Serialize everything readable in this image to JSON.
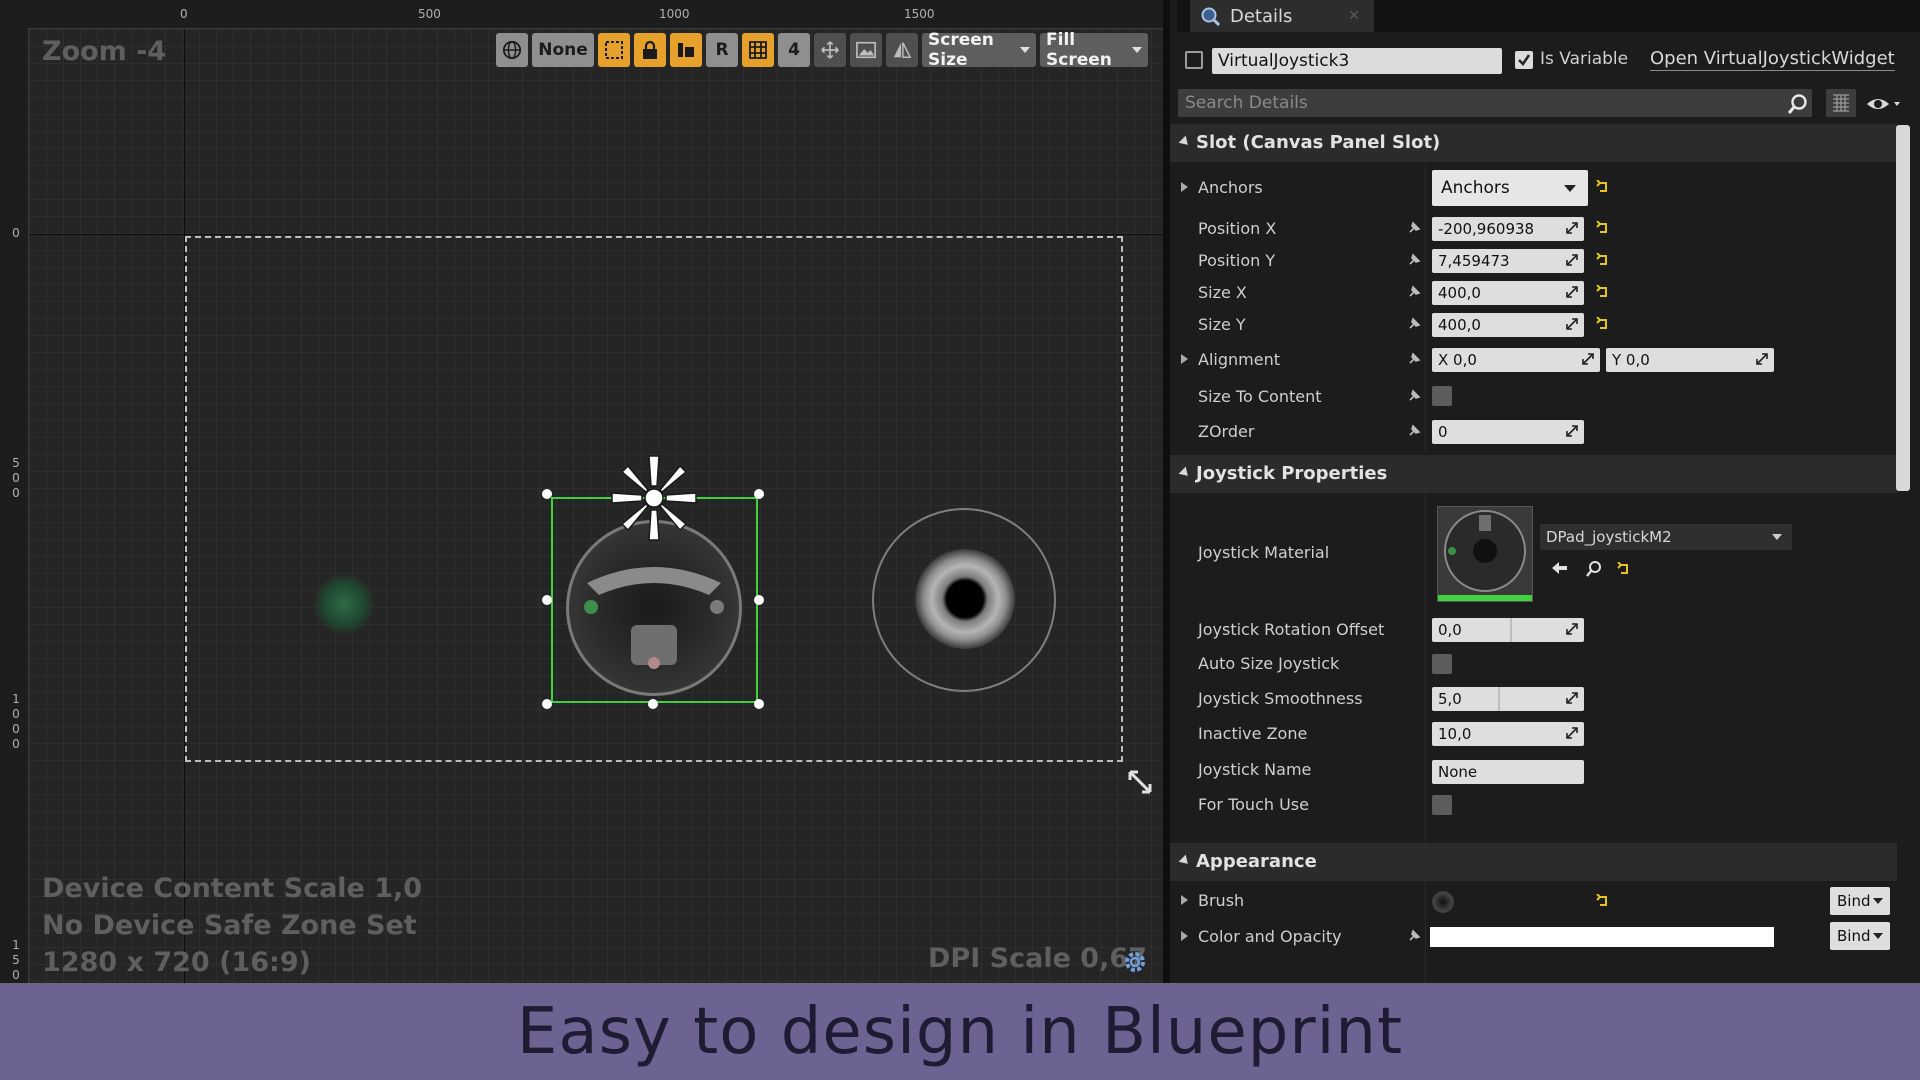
{
  "designer": {
    "zoom_label": "Zoom -4",
    "ruler_top_ticks": [
      "0",
      "500",
      "1000",
      "1500"
    ],
    "ruler_left_ticks": [
      "0",
      "500",
      "1000",
      "150"
    ],
    "device_content_scale": "Device Content Scale 1,0",
    "safe_zone": "No Device Safe Zone Set",
    "resolution": "1280 x 720 (16:9)",
    "dpi_scale": "DPI Scale 0,67",
    "toolbar": {
      "none_label": "None",
      "r_label": "R",
      "grid_snap_value": "4",
      "screen_size_label": "Screen Size",
      "fill_screen_label": "Fill Screen"
    }
  },
  "details": {
    "tab_label": "Details",
    "widget_name": "VirtualJoystick3",
    "is_variable_label": "Is Variable",
    "is_variable_checked": true,
    "open_widget_link": "Open VirtualJoystickWidget",
    "search_placeholder": "Search Details",
    "slot_section": "Slot (Canvas Panel Slot)",
    "anchors_label": "Anchors",
    "anchors_value": "Anchors",
    "position_x_label": "Position X",
    "position_x_value": "-200,960938",
    "position_y_label": "Position Y",
    "position_y_value": "7,459473",
    "size_x_label": "Size X",
    "size_x_value": "400,0",
    "size_y_label": "Size Y",
    "size_y_value": "400,0",
    "alignment_label": "Alignment",
    "alignment_x": "X  0,0",
    "alignment_y": "Y  0,0",
    "size_to_content_label": "Size To Content",
    "zorder_label": "ZOrder",
    "zorder_value": "0",
    "joystick_section": "Joystick Properties",
    "joystick_material_label": "Joystick Material",
    "joystick_material_value": "DPad_joystickM2",
    "rotation_offset_label": "Joystick Rotation Offset",
    "rotation_offset_value": "0,0",
    "auto_size_label": "Auto Size Joystick",
    "smoothness_label": "Joystick Smoothness",
    "smoothness_value": "5,0",
    "inactive_zone_label": "Inactive Zone",
    "inactive_zone_value": "10,0",
    "joystick_name_label": "Joystick Name",
    "joystick_name_value": "None",
    "touch_use_label": "For Touch Use",
    "appearance_section": "Appearance",
    "brush_label": "Brush",
    "color_opacity_label": "Color and Opacity",
    "bind_label": "Bind"
  },
  "caption": "Easy to design in Blueprint",
  "colors": {
    "selection_green": "#3fd43f",
    "toolbar_orange": "#e6a02c",
    "caption_bg": "#6c6392",
    "reset_arrow_yellow": "#e8c51e"
  }
}
